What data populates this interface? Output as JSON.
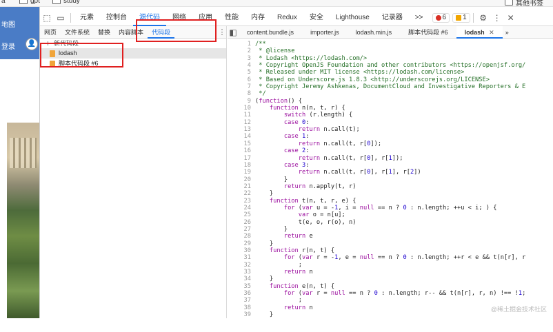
{
  "bookmarks": {
    "items": [
      "gpt",
      "study"
    ],
    "right_item": "其他书签"
  },
  "webpage": {
    "map_label": "地图",
    "login_label": "登录"
  },
  "devtools": {
    "tabs": [
      "元素",
      "控制台",
      "源代码",
      "网络",
      "应用",
      "性能",
      "内存",
      "Redux",
      "安全",
      "Lighthouse",
      "记录器"
    ],
    "active_tab": "源代码",
    "more": ">>",
    "errors": "6",
    "warnings": "1",
    "navigator_tabs": [
      "网页",
      "文件系统",
      "替换",
      "内容脚本",
      "代码段"
    ],
    "active_navigator_tab": "代码段",
    "new_snippet": "新代码段",
    "snippets": [
      "lodash",
      "脚本代码段 #6"
    ],
    "selected_snippet": "lodash",
    "editor_tabs": [
      "content.bundle.js",
      "importer.js",
      "lodash.min.js",
      "脚本代码段 #6",
      "lodash"
    ],
    "active_editor_tab": "lodash",
    "editor_more": "»",
    "watermark": "@稀土掘金技术社区"
  },
  "code_lines": [
    "/**",
    " * @license",
    " * Lodash <https://lodash.com/>",
    " * Copyright OpenJS Foundation and other contributors <https://openjsf.org/",
    " * Released under MIT license <https://lodash.com/license>",
    " * Based on Underscore.js 1.8.3 <http://underscorejs.org/LICENSE>",
    " * Copyright Jeremy Ashkenas, DocumentCloud and Investigative Reporters & E",
    " */",
    "(function() {",
    "    function n(n, t, r) {",
    "        switch (r.length) {",
    "        case 0:",
    "            return n.call(t);",
    "        case 1:",
    "            return n.call(t, r[0]);",
    "        case 2:",
    "            return n.call(t, r[0], r[1]);",
    "        case 3:",
    "            return n.call(t, r[0], r[1], r[2])",
    "        }",
    "        return n.apply(t, r)",
    "    }",
    "    function t(n, t, r, e) {",
    "        for (var u = -1, i = null == n ? 0 : n.length; ++u < i; ) {",
    "            var o = n[u];",
    "            t(e, o, r(o), n)",
    "        }",
    "        return e",
    "    }",
    "    function r(n, t) {",
    "        for (var r = -1, e = null == n ? 0 : n.length; ++r < e && t(n[r], r",
    "            ;",
    "        return n",
    "    }",
    "    function e(n, t) {",
    "        for (var r = null == n ? 0 : n.length; r-- && t(n[r], r, n) !== !1;",
    "            ;",
    "        return n",
    "    }"
  ]
}
